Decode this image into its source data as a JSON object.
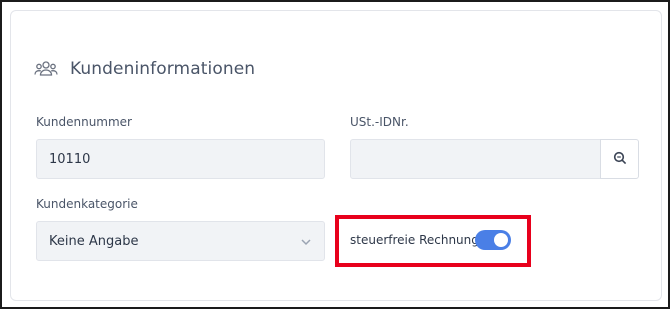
{
  "section": {
    "title": "Kundeninformationen",
    "icon": "users-icon"
  },
  "fields": {
    "customer_number": {
      "label": "Kundennummer",
      "value": "10110"
    },
    "vat_id": {
      "label": "USt.-IDNr.",
      "value": ""
    },
    "customer_category": {
      "label": "Kundenkategorie",
      "value": "Keine Angabe"
    }
  },
  "toggle": {
    "label": "steuerfreie Rechnung",
    "state": "on",
    "color": "#4a7fe6"
  },
  "highlight_color": "#e8001c"
}
